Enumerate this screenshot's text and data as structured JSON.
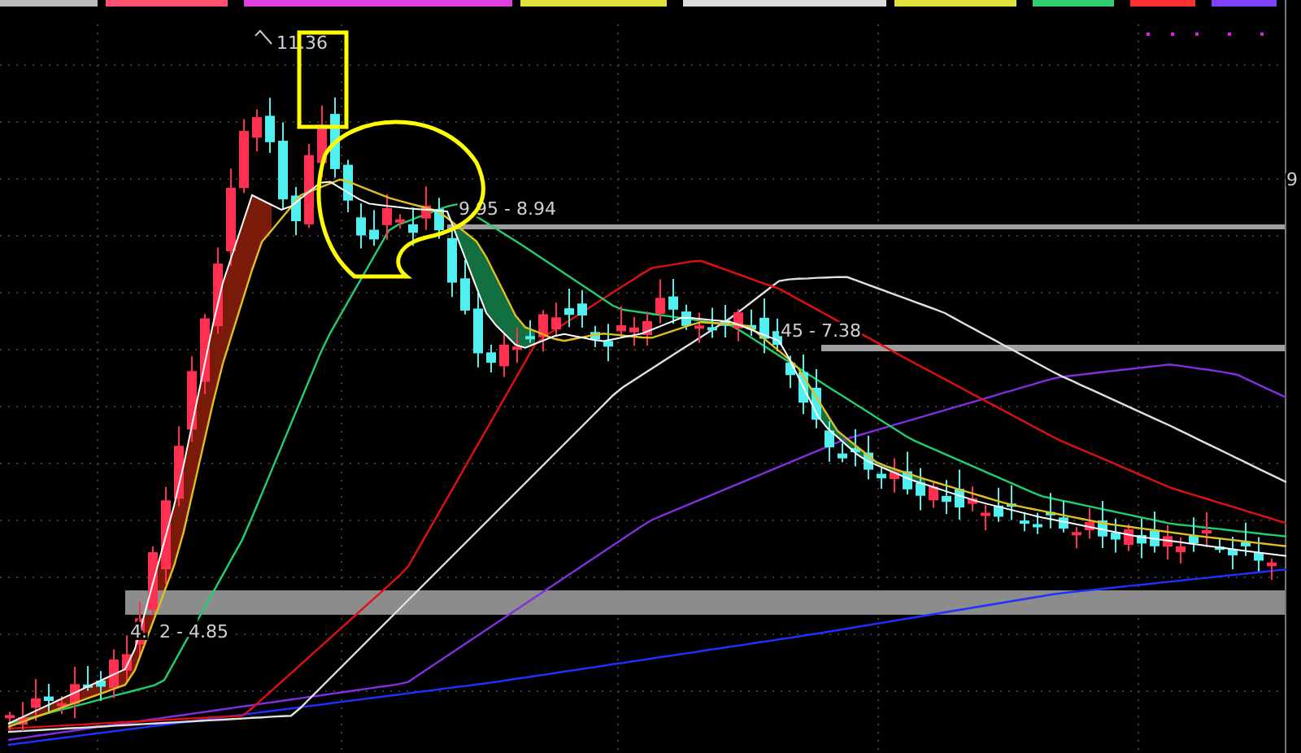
{
  "chart": {
    "price_labels": [
      {
        "text": "11.36"
      },
      {
        "text": "9.95 - 8.94"
      },
      {
        "text": "45 - 7.38"
      },
      {
        "text": "4."
      },
      {
        "text": "2 - 4.85"
      }
    ],
    "axis_labels": [
      {
        "text": "9"
      }
    ]
  }
}
